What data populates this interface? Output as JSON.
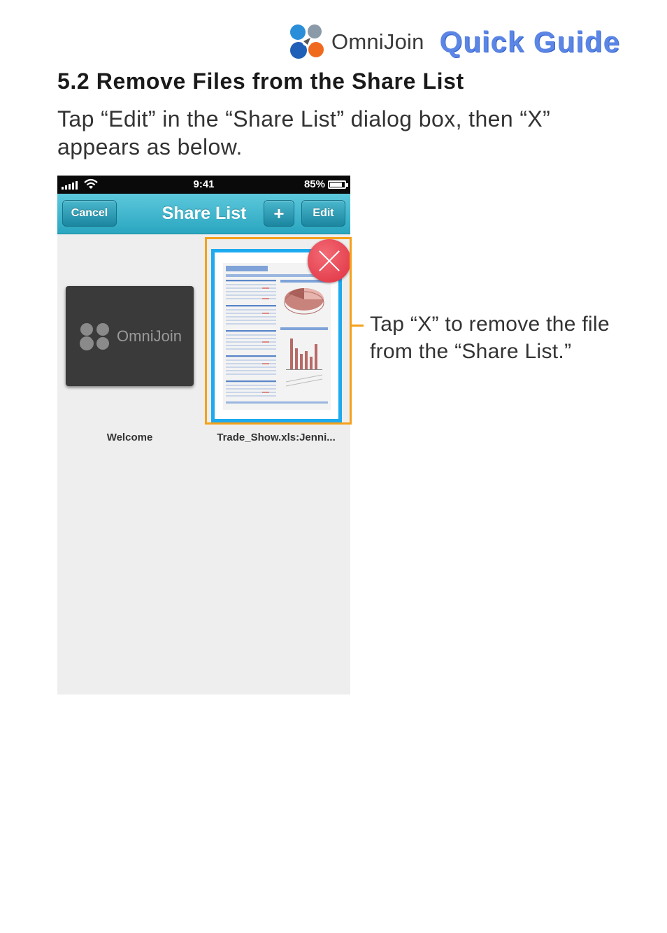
{
  "header": {
    "brand_name": "OmniJoin",
    "guide_title": "Quick Guide",
    "logo_icon": "omnijoin-logo-icon"
  },
  "section": {
    "title": "5.2 Remove Files from the Share List",
    "intro": "Tap “Edit” in the “Share List” dialog box, then “X” appears as below."
  },
  "phone": {
    "status_bar": {
      "time": "9:41",
      "battery_percent": "85%",
      "battery_level": 0.85
    },
    "nav": {
      "cancel_label": "Cancel",
      "title": "Share List",
      "add_label": "+",
      "edit_label": "Edit"
    },
    "files": [
      {
        "label": "Welcome",
        "thumb_brand": "OmniJoin"
      },
      {
        "label": "Trade_Show.xls:Jenni..."
      }
    ]
  },
  "callout": {
    "text": "Tap “X” to remove the file from the “Share List.”"
  },
  "colors": {
    "guide_blue": "#5b86e6",
    "nav_teal": "#2aa6c0",
    "highlight_orange": "#f5a01a",
    "remove_red": "#e0303f",
    "thumb_border_blue": "#1eaaf0"
  }
}
